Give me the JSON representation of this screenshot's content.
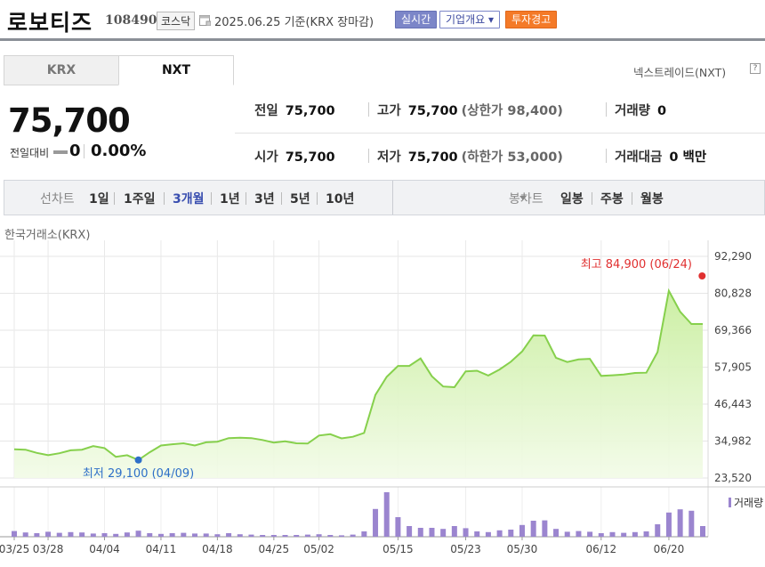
{
  "header": {
    "stock_name": "로보티즈",
    "stock_code": "108490",
    "market": "코스닥",
    "calendar_icon": "calendar-icon",
    "date_text": "2025.06.25  기준(KRX 장마감)",
    "realtime_label": "실시간",
    "company_label": "기업개요 ▾",
    "warning_label": "투자경고",
    "colors": {
      "realtime": "#7c86c8",
      "warning": "#f47a28"
    }
  },
  "market_tabs": {
    "tabs": [
      {
        "label": "KRX",
        "active": false
      },
      {
        "label": "NXT",
        "active": true
      }
    ],
    "nxt_link": "넥스트레이드(NXT)",
    "help_icon": "help-icon",
    "help_glyph": "?"
  },
  "price": {
    "current": "75,700",
    "change_label": "전일대비",
    "change_value": "0",
    "change_percent": "0.00%"
  },
  "quotes": {
    "prev_close": {
      "label": "전일",
      "value": "75,700"
    },
    "high": {
      "label": "고가",
      "value": "75,700",
      "sub": "(상한가 98,400)"
    },
    "volume": {
      "label": "거래량",
      "value": "0"
    },
    "open": {
      "label": "시가",
      "value": "75,700"
    },
    "low": {
      "label": "저가",
      "value": "75,700",
      "sub": "(하한가 53,000)"
    },
    "amount": {
      "label": "거래대금",
      "value": "0 백만"
    }
  },
  "period_bar": {
    "line_label": "선차트",
    "line_periods": [
      "1일",
      "1주일",
      "3개월",
      "1년",
      "3년",
      "5년",
      "10년"
    ],
    "active_period": "3개월",
    "candle_label": "봉차트",
    "candle_periods": [
      "일봉",
      "주봉",
      "월봉"
    ]
  },
  "exchange_label": "한국거래소(KRX)",
  "chart_data": {
    "type": "area",
    "x": [
      "03/25",
      "03/26",
      "03/27",
      "03/28",
      "03/31",
      "04/01",
      "04/02",
      "04/03",
      "04/04",
      "04/07",
      "04/08",
      "04/09",
      "04/10",
      "04/11",
      "04/14",
      "04/15",
      "04/16",
      "04/17",
      "04/18",
      "04/21",
      "04/22",
      "04/23",
      "04/24",
      "04/25",
      "04/28",
      "04/29",
      "04/30",
      "05/02",
      "05/07",
      "05/08",
      "05/09",
      "05/12",
      "05/13",
      "05/14",
      "05/15",
      "05/16",
      "05/19",
      "05/20",
      "05/21",
      "05/22",
      "05/23",
      "05/26",
      "05/27",
      "05/28",
      "05/29",
      "05/30",
      "06/02",
      "06/04",
      "06/05",
      "06/09",
      "06/10",
      "06/11",
      "06/12",
      "06/13",
      "06/16",
      "06/17",
      "06/18",
      "06/19",
      "06/20",
      "06/23",
      "06/24",
      "06/25"
    ],
    "series": [
      {
        "values": [
          32400,
          32300,
          31300,
          30600,
          31200,
          32100,
          32300,
          33400,
          32800,
          30100,
          30600,
          29100,
          31500,
          33600,
          34000,
          34300,
          33600,
          34600,
          34800,
          35900,
          36000,
          35900,
          35300,
          34500,
          34900,
          34300,
          34200,
          36700,
          37100,
          35800,
          36300,
          37500,
          49300,
          54900,
          58300,
          58300,
          60600,
          55100,
          51900,
          51700,
          56600,
          56800,
          55300,
          57200,
          59600,
          62800,
          67800,
          67700,
          60800,
          59500,
          60300,
          60500,
          55200,
          55400,
          55600,
          56100,
          56200,
          62600,
          81600,
          75100,
          71300,
          71300
        ]
      }
    ],
    "volume": [
      1.6,
      1.2,
      1.0,
      1.4,
      1.1,
      1.3,
      1.2,
      0.9,
      1.0,
      0.8,
      1.2,
      1.7,
      1.0,
      0.8,
      1.0,
      1.1,
      0.9,
      0.9,
      0.7,
      1.0,
      0.7,
      0.6,
      0.5,
      0.5,
      0.5,
      0.5,
      0.6,
      0.7,
      0.5,
      0.4,
      0.6,
      1.5,
      7.8,
      12.5,
      5.5,
      3.0,
      2.5,
      2.5,
      2.2,
      3.0,
      2.4,
      1.5,
      1.3,
      1.8,
      2.0,
      3.3,
      4.5,
      4.6,
      2.2,
      1.4,
      1.6,
      1.4,
      1.0,
      1.3,
      1.1,
      1.3,
      1.5,
      3.5,
      6.8,
      7.7,
      7.3,
      3.0
    ],
    "y_ticks": [
      "92,290",
      "80,828",
      "69,366",
      "57,905",
      "46,443",
      "34,982",
      "23,520"
    ],
    "ylim": [
      23520,
      92290
    ],
    "x_tick_labels": [
      "03/25",
      "03/28",
      "04/04",
      "04/11",
      "04/18",
      "04/25",
      "05/02",
      "05/15",
      "05/23",
      "05/30",
      "06/12",
      "06/20"
    ],
    "high_annotation": {
      "label": "최고",
      "value": "84,900",
      "date": "(06/24)",
      "price": 84900
    },
    "low_annotation": {
      "label": "최저",
      "value": "29,100",
      "date": "(04/09)",
      "price": 29100
    },
    "volume_legend": "거래량",
    "grid": true,
    "colors": {
      "line": "#86d04c",
      "fill": "#d8f3b8",
      "high": "#e03030",
      "low": "#2e6fc8",
      "volume": "#9b85cf"
    }
  }
}
